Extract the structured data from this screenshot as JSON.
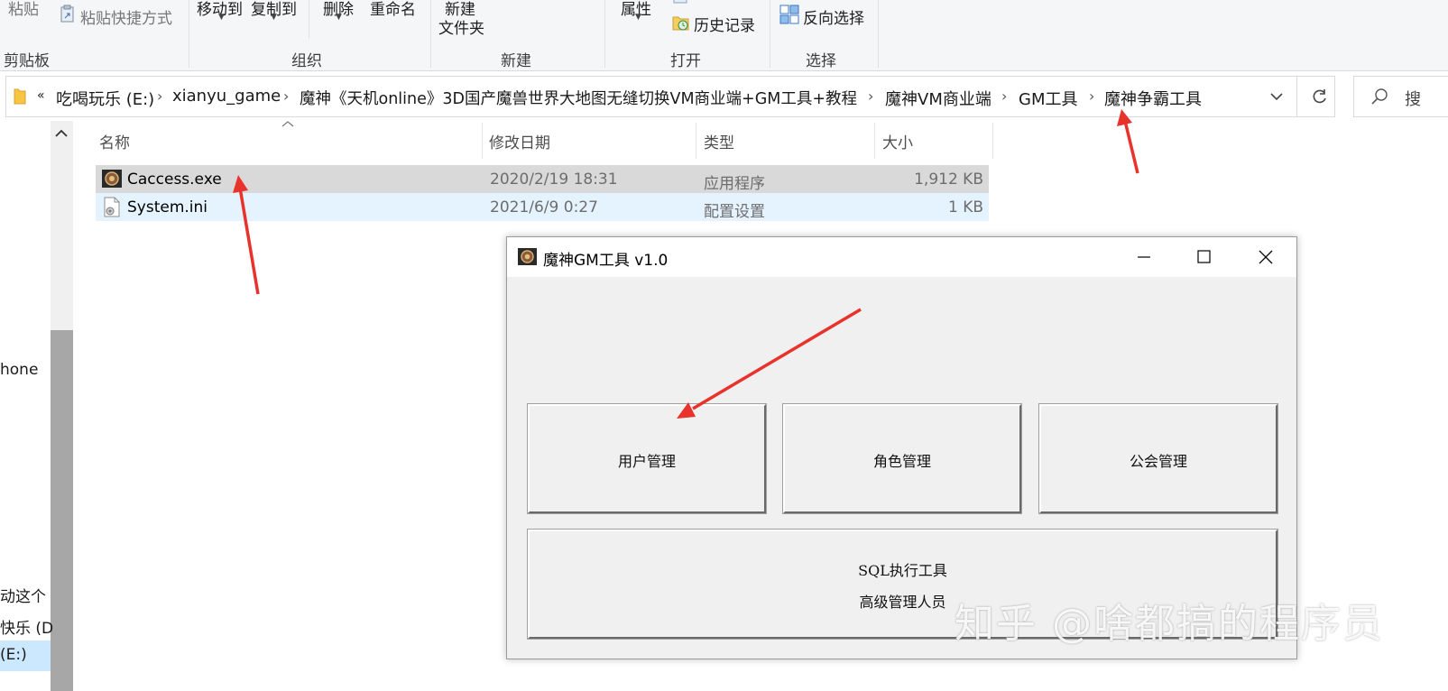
{
  "ribbon": {
    "paste": "粘贴",
    "paste_shortcut": "粘贴快捷方式",
    "clipboard_group": "剪贴板",
    "move_to": "移动到",
    "copy_to": "复制到",
    "delete": "删除",
    "rename": "重命名",
    "organize_group": "组织",
    "new_folder_line1": "新建",
    "new_folder_line2": "文件夹",
    "new_group": "新建",
    "properties": "属性",
    "history": "历史记录",
    "open_group": "打开",
    "invert_selection": "反向选择",
    "select_group": "选择"
  },
  "address": {
    "overflow": "«",
    "crumbs": [
      "吃喝玩乐 (E:)",
      "xianyu_game",
      "魔神《天机online》3D国产魔兽世界大地图无缝切换VM商业端+GM工具+教程",
      "魔神VM商业端",
      "GM工具",
      "魔神争霸工具"
    ],
    "search_placeholder": "搜"
  },
  "nav": {
    "items": [
      "hone",
      "动这个",
      "快乐 (D",
      "(E:)"
    ]
  },
  "columns": {
    "name": "名称",
    "modified": "修改日期",
    "type": "类型",
    "size": "大小"
  },
  "files": [
    {
      "name": "Caccess.exe",
      "modified": "2020/2/19 18:31",
      "type": "应用程序",
      "size": "1,912 KB"
    },
    {
      "name": "System.ini",
      "modified": "2021/6/9 0:27",
      "type": "配置设置",
      "size": "1 KB"
    }
  ],
  "dialog": {
    "title": "魔神GM工具 v1.0",
    "buttons": {
      "user_mgmt": "用户管理",
      "role_mgmt": "角色管理",
      "guild_mgmt": "公会管理",
      "sql_line1": "SQL执行工具",
      "sql_line2": "高级管理人员"
    }
  },
  "watermark": "知乎 @啥都搞的程序员",
  "colors": {
    "annotation_arrow": "#e8322c",
    "selection_row": "#d9d9d9",
    "hover_row": "#e5f3ff",
    "nav_selection": "#cce8ff"
  }
}
